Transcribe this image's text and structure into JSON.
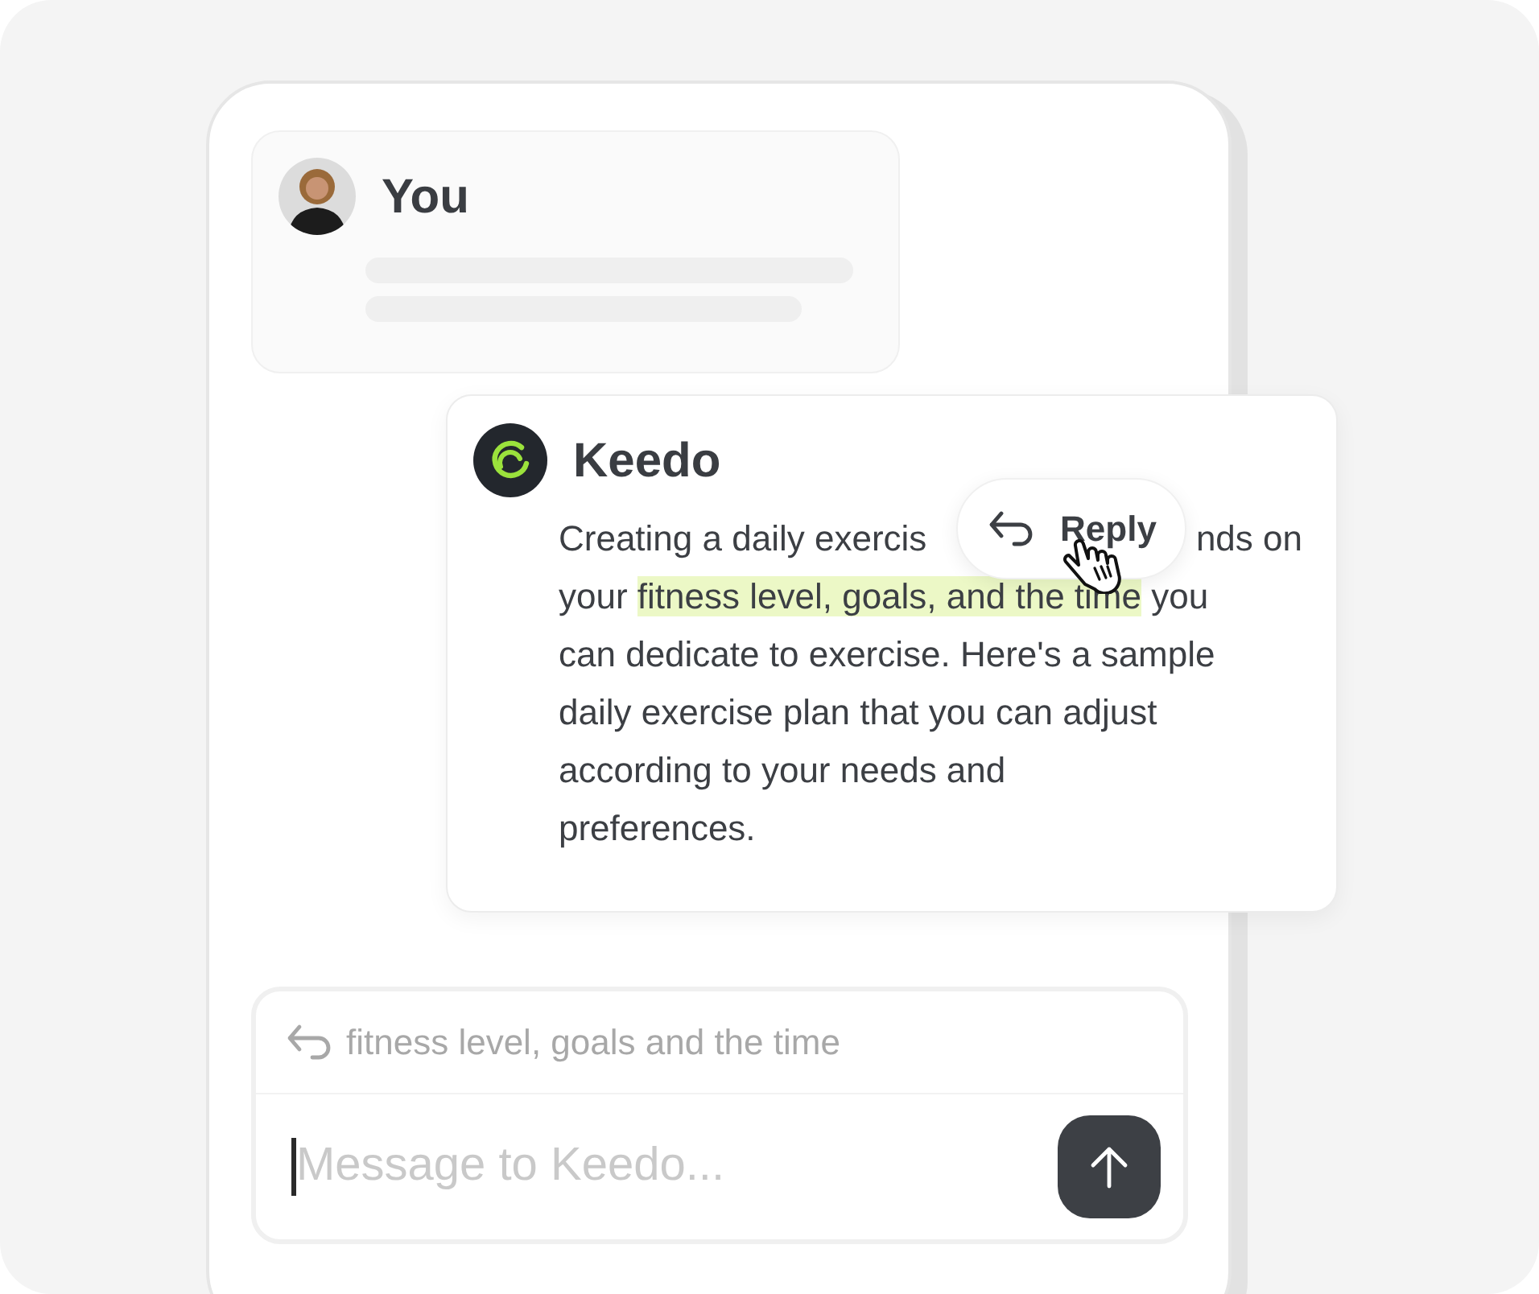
{
  "user_message": {
    "author": "You"
  },
  "assistant_message": {
    "author": "Keedo",
    "lines": [
      [
        {
          "text": "Creating a daily exercis",
          "highlighted": false
        },
        {
          "text": "nds on",
          "highlighted": false
        }
      ],
      [
        {
          "text": "your ",
          "highlighted": false
        },
        {
          "text": "fitness level, goals, and the time",
          "highlighted": true
        },
        {
          "text": " you",
          "highlighted": false
        }
      ],
      [
        {
          "text": "can dedicate to exercise. Here's a sample",
          "highlighted": false
        }
      ],
      [
        {
          "text": "daily exercise plan that you can adjust",
          "highlighted": false
        }
      ],
      [
        {
          "text": "according to your needs and",
          "highlighted": false
        }
      ],
      [
        {
          "text": "preferences.",
          "highlighted": false
        }
      ]
    ]
  },
  "reply_action": {
    "label": "Reply"
  },
  "composer": {
    "quote": "fitness level, goals and the time",
    "placeholder": "Message to Keedo..."
  }
}
